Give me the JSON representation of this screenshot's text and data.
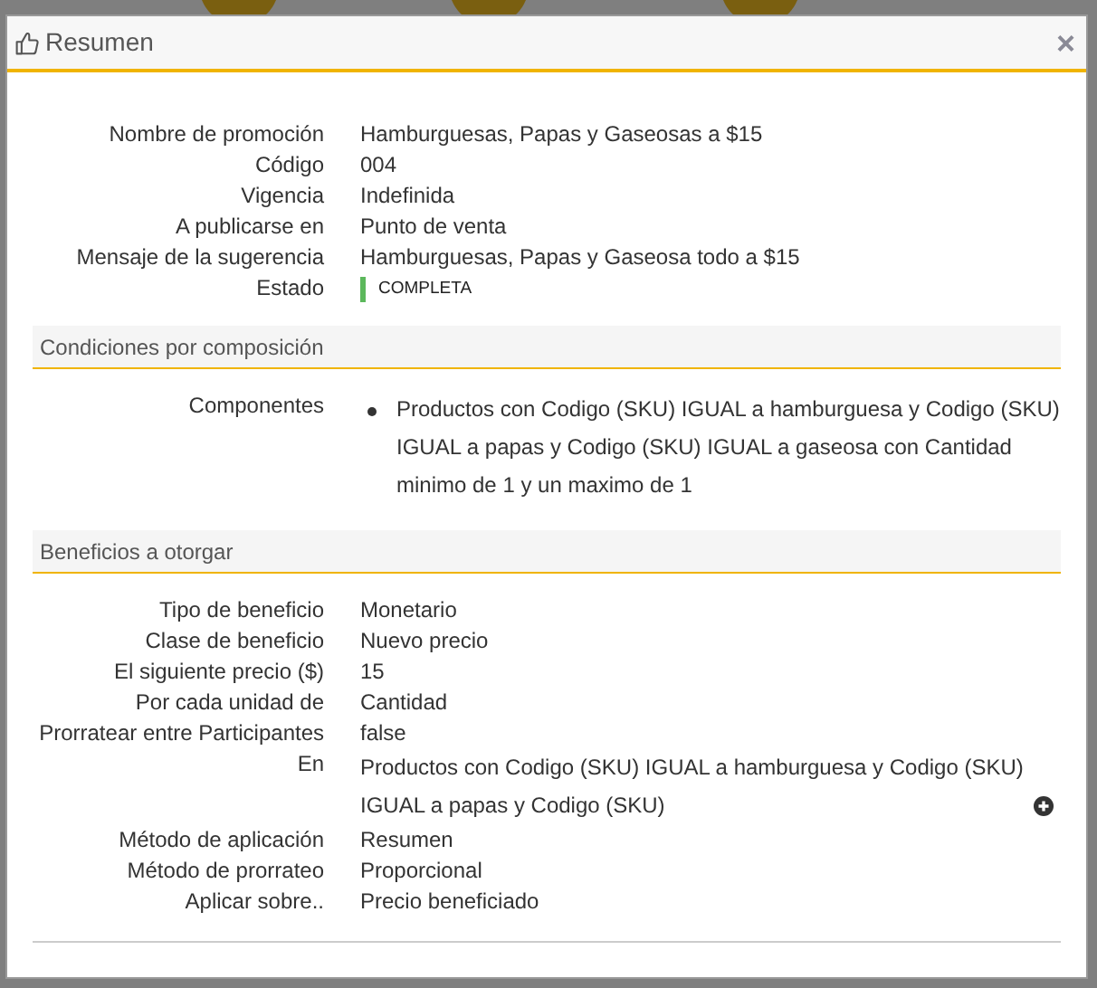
{
  "dialog": {
    "title": "Resumen",
    "close": "×"
  },
  "summary": [
    {
      "label": "Nombre de promoción",
      "value": "Hamburguesas, Papas y Gaseosas a $15"
    },
    {
      "label": "Código",
      "value": "004"
    },
    {
      "label": "Vigencia",
      "value": "Indefinida"
    },
    {
      "label": "A publicarse en",
      "value": "Punto de venta"
    },
    {
      "label": "Mensaje de la sugerencia",
      "value": "Hamburguesas, Papas y Gaseosa todo a $15"
    },
    {
      "label": "Estado",
      "value": "COMPLETA",
      "kind": "status"
    }
  ],
  "sections": [
    {
      "title": "Condiciones por composición",
      "rows": [
        {
          "label": "Componentes",
          "kind": "list",
          "items": [
            "Productos con Codigo (SKU) IGUAL a hamburguesa y Codigo (SKU) IGUAL a papas y Codigo (SKU) IGUAL a gaseosa con Cantidad minimo de 1 y un maximo de 1"
          ]
        }
      ]
    },
    {
      "title": "Beneficios a otorgar",
      "rows": [
        {
          "label": "Tipo de beneficio",
          "value": "Monetario"
        },
        {
          "label": "Clase de beneficio",
          "value": "Nuevo precio"
        },
        {
          "label": "El siguiente precio ($)",
          "value": "15"
        },
        {
          "label": "Por cada unidad de",
          "value": "Cantidad"
        },
        {
          "label": "Prorratear entre Participantes",
          "value": "false"
        },
        {
          "label": "En",
          "value": "Productos con Codigo (SKU) IGUAL a hamburguesa y Codigo (SKU) IGUAL a papas y Codigo (SKU)",
          "kind": "expandable"
        },
        {
          "label": "Método de aplicación",
          "value": "Resumen"
        },
        {
          "label": "Método de prorrateo",
          "value": "Proporcional"
        },
        {
          "label": "Aplicar sobre..",
          "value": "Precio beneficiado"
        }
      ]
    }
  ]
}
